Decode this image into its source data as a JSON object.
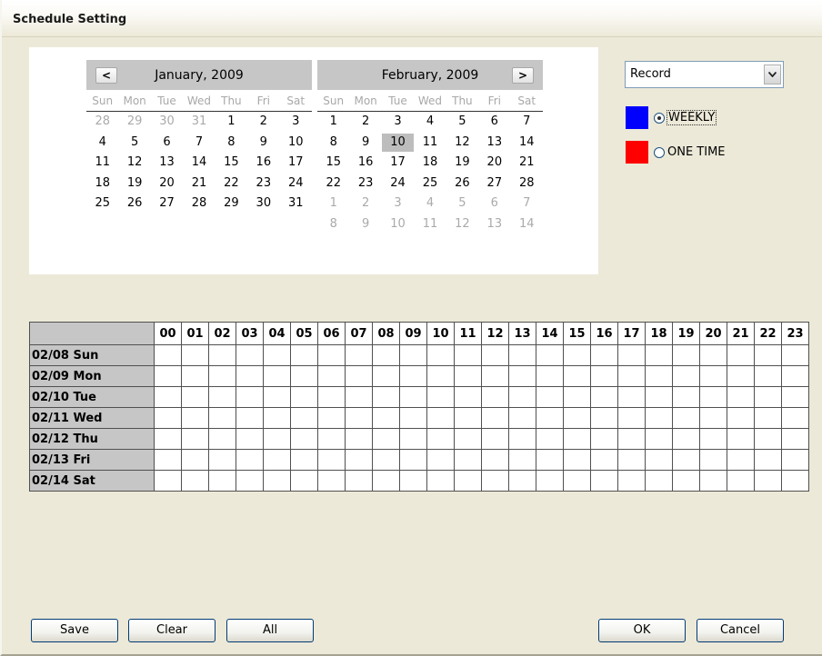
{
  "window": {
    "title": "Schedule Setting"
  },
  "calendar": {
    "prev_label": "<",
    "next_label": ">",
    "weekdays": [
      "Sun",
      "Mon",
      "Tue",
      "Wed",
      "Thu",
      "Fri",
      "Sat"
    ],
    "months": [
      {
        "title": "January, 2009",
        "weeks": [
          [
            {
              "d": "28",
              "o": 1
            },
            {
              "d": "29",
              "o": 1
            },
            {
              "d": "30",
              "o": 1
            },
            {
              "d": "31",
              "o": 1
            },
            {
              "d": "1"
            },
            {
              "d": "2"
            },
            {
              "d": "3"
            }
          ],
          [
            {
              "d": "4"
            },
            {
              "d": "5"
            },
            {
              "d": "6"
            },
            {
              "d": "7"
            },
            {
              "d": "8"
            },
            {
              "d": "9"
            },
            {
              "d": "10"
            }
          ],
          [
            {
              "d": "11"
            },
            {
              "d": "12"
            },
            {
              "d": "13"
            },
            {
              "d": "14"
            },
            {
              "d": "15"
            },
            {
              "d": "16"
            },
            {
              "d": "17"
            }
          ],
          [
            {
              "d": "18"
            },
            {
              "d": "19"
            },
            {
              "d": "20"
            },
            {
              "d": "21"
            },
            {
              "d": "22"
            },
            {
              "d": "23"
            },
            {
              "d": "24"
            }
          ],
          [
            {
              "d": "25"
            },
            {
              "d": "26"
            },
            {
              "d": "27"
            },
            {
              "d": "28"
            },
            {
              "d": "29"
            },
            {
              "d": "30"
            },
            {
              "d": "31"
            }
          ]
        ]
      },
      {
        "title": "February, 2009",
        "weeks": [
          [
            {
              "d": "1"
            },
            {
              "d": "2"
            },
            {
              "d": "3"
            },
            {
              "d": "4"
            },
            {
              "d": "5"
            },
            {
              "d": "6"
            },
            {
              "d": "7"
            }
          ],
          [
            {
              "d": "8"
            },
            {
              "d": "9"
            },
            {
              "d": "10",
              "sel": 1
            },
            {
              "d": "11"
            },
            {
              "d": "12"
            },
            {
              "d": "13"
            },
            {
              "d": "14"
            }
          ],
          [
            {
              "d": "15"
            },
            {
              "d": "16"
            },
            {
              "d": "17"
            },
            {
              "d": "18"
            },
            {
              "d": "19"
            },
            {
              "d": "20"
            },
            {
              "d": "21"
            }
          ],
          [
            {
              "d": "22"
            },
            {
              "d": "23"
            },
            {
              "d": "24"
            },
            {
              "d": "25"
            },
            {
              "d": "26"
            },
            {
              "d": "27"
            },
            {
              "d": "28"
            }
          ],
          [
            {
              "d": "1",
              "o": 1
            },
            {
              "d": "2",
              "o": 1
            },
            {
              "d": "3",
              "o": 1
            },
            {
              "d": "4",
              "o": 1
            },
            {
              "d": "5",
              "o": 1
            },
            {
              "d": "6",
              "o": 1
            },
            {
              "d": "7",
              "o": 1
            }
          ],
          [
            {
              "d": "8",
              "o": 1
            },
            {
              "d": "9",
              "o": 1
            },
            {
              "d": "10",
              "o": 1
            },
            {
              "d": "11",
              "o": 1
            },
            {
              "d": "12",
              "o": 1
            },
            {
              "d": "13",
              "o": 1
            },
            {
              "d": "14",
              "o": 1
            }
          ]
        ]
      }
    ]
  },
  "mode_select": {
    "value": "Record",
    "arrow_icon": "chevron-down-icon"
  },
  "legend": {
    "weekly": {
      "label": "WEEKLY",
      "color": "#0000ff",
      "selected": true
    },
    "one_time": {
      "label": "ONE TIME",
      "color": "#ff0000",
      "selected": false
    }
  },
  "schedule": {
    "hours": [
      "00",
      "01",
      "02",
      "03",
      "04",
      "05",
      "06",
      "07",
      "08",
      "09",
      "10",
      "11",
      "12",
      "13",
      "14",
      "15",
      "16",
      "17",
      "18",
      "19",
      "20",
      "21",
      "22",
      "23"
    ],
    "days": [
      "02/08 Sun",
      "02/09 Mon",
      "02/10 Tue",
      "02/11 Wed",
      "02/12 Thu",
      "02/13 Fri",
      "02/14 Sat"
    ]
  },
  "buttons": {
    "save": "Save",
    "clear": "Clear",
    "all": "All",
    "ok": "OK",
    "cancel": "Cancel"
  }
}
